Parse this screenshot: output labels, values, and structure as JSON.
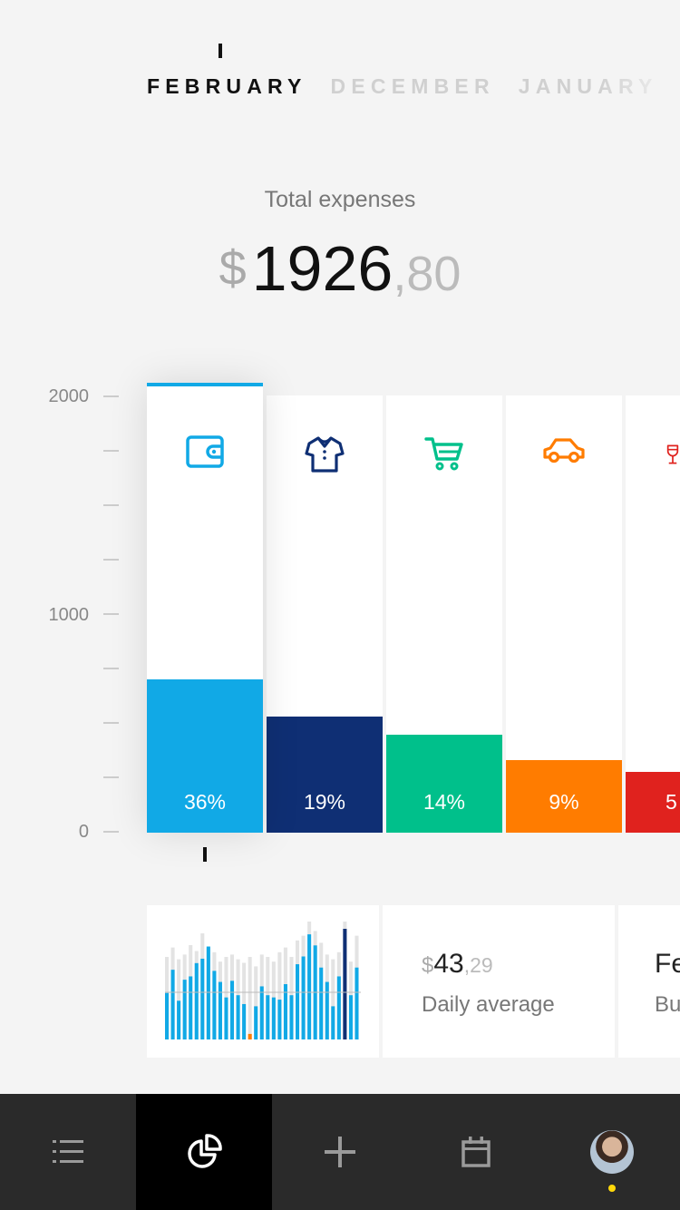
{
  "months": {
    "items": [
      "FEBRUARY",
      "DECEMBER",
      "JANUARY"
    ],
    "active_index": 0
  },
  "summary": {
    "label": "Total expenses",
    "currency": "$",
    "integer": "1926",
    "decimal": ",80"
  },
  "chart_data": {
    "type": "bar",
    "categories": [
      "wallet",
      "clothes",
      "shopping",
      "car",
      "drinks"
    ],
    "values": [
      700,
      530,
      450,
      330,
      280
    ],
    "percent_labels": [
      "36%",
      "19%",
      "14%",
      "9%",
      "5"
    ],
    "colors": [
      "#11a9e6",
      "#0f2f74",
      "#00c08b",
      "#ff7c00",
      "#e0221e"
    ],
    "icons": [
      "wallet-icon",
      "shirt-icon",
      "cart-icon",
      "car-icon",
      "wine-glass-icon"
    ],
    "ylim": [
      0,
      2000
    ],
    "y_tick_labels": [
      "2000",
      "1000",
      "0"
    ],
    "selected_index": 0
  },
  "daily_chart": {
    "values": [
      0.42,
      0.63,
      0.35,
      0.54,
      0.57,
      0.69,
      0.73,
      0.84,
      0.62,
      0.52,
      0.38,
      0.53,
      0.4,
      0.32,
      0.05,
      0.3,
      0.48,
      0.4,
      0.38,
      0.36,
      0.5,
      0.4,
      0.68,
      0.75,
      0.95,
      0.85,
      0.65,
      0.52,
      0.3,
      0.57,
      1.0,
      0.4,
      0.65
    ],
    "background_values": [
      0.7,
      0.78,
      0.68,
      0.72,
      0.8,
      0.75,
      0.9,
      0.78,
      0.74,
      0.66,
      0.7,
      0.72,
      0.68,
      0.65,
      0.7,
      0.62,
      0.72,
      0.7,
      0.66,
      0.74,
      0.78,
      0.7,
      0.84,
      0.88,
      1.0,
      0.92,
      0.82,
      0.72,
      0.68,
      0.74,
      1.0,
      0.66,
      0.88
    ],
    "highlight_index": 30,
    "low_index": 14,
    "colors": {
      "bar": "#11a9e6",
      "highlight": "#0f2f74",
      "low": "#ff7c00",
      "background": "#e3e3e3"
    }
  },
  "daily_average": {
    "currency": "$",
    "integer": "43",
    "decimal": ",29",
    "label": "Daily average"
  },
  "card3": {
    "title": "Fe",
    "subtitle": "Bu"
  },
  "nav": {
    "items": [
      "list-icon",
      "pie-chart-icon",
      "plus-icon",
      "calendar-icon",
      "avatar"
    ],
    "active_index": 1
  }
}
